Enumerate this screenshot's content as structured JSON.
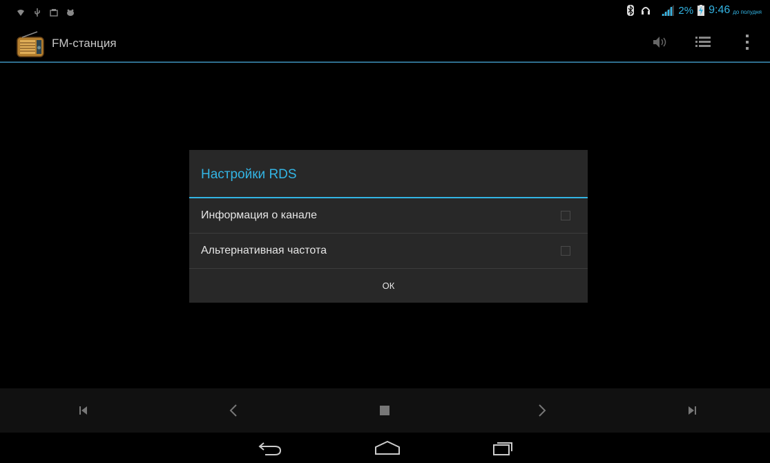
{
  "status_bar": {
    "left_icons": [
      "wifi-icon",
      "usb-icon",
      "storage-icon",
      "android-debug-icon"
    ],
    "right_icons": [
      "bluetooth-icon",
      "headphones-icon",
      "signal-icon",
      "battery-charging-icon"
    ],
    "battery_percent": "2%",
    "time": "9:46",
    "time_suffix": "до полудня",
    "accent_color": "#33b5e5"
  },
  "action_bar": {
    "app_icon": "radio-icon",
    "title": "FM-станция",
    "actions": [
      "speaker-icon",
      "list-icon",
      "overflow-menu-icon"
    ]
  },
  "dialog": {
    "title": "Настройки RDS",
    "options": [
      {
        "label": "Информация о канале",
        "checked": false
      },
      {
        "label": "Альтернативная частота",
        "checked": false
      }
    ],
    "ok_label": "ОК"
  },
  "playback_controls": [
    "skip-previous-icon",
    "seek-back-icon",
    "stop-icon",
    "seek-forward-icon",
    "skip-next-icon"
  ],
  "nav_bar": [
    "back-icon",
    "home-icon",
    "recents-icon"
  ]
}
